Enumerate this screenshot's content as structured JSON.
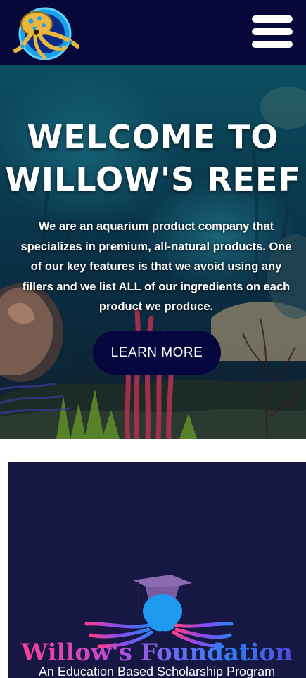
{
  "header": {
    "logo_icon": "octopus-logo-icon",
    "menu_icon": "hamburger-menu-icon",
    "background_color": "#07073a"
  },
  "hero": {
    "title": "WELCOME TO\nWILLOW'S REEF",
    "description": "We are an aquarium product company that specializes in premium, all-natural products. One of our key features is that we avoid using any fillers and we list ALL of our ingredients on each product we produce.",
    "button_label": "LEARN MORE",
    "button_color": "#06063f"
  },
  "foundation": {
    "logo_icon": "octopus-graduation-cap-icon",
    "name": "Willow's Foundation",
    "subtitle": "An Education Based Scholarship Program",
    "background_color": "#171744"
  }
}
